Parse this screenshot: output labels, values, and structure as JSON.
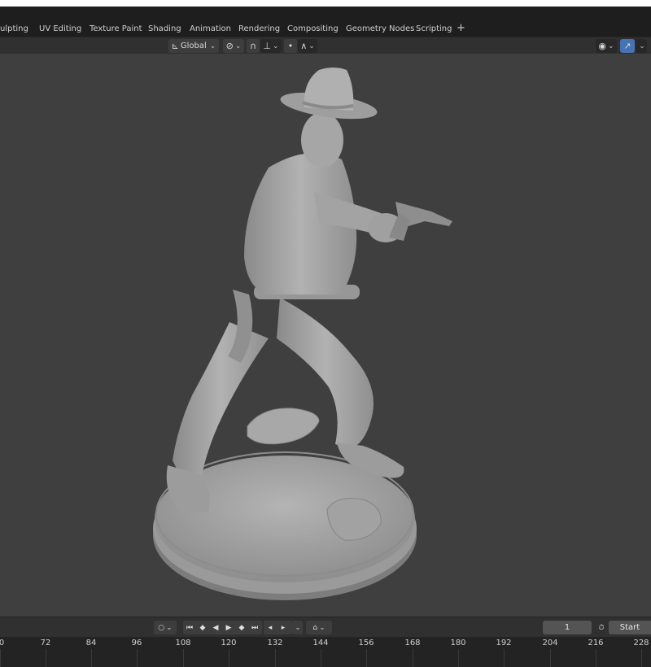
{
  "workspace_tabs": [
    {
      "label": "ulpting"
    },
    {
      "label": "UV Editing"
    },
    {
      "label": "Texture Paint"
    },
    {
      "label": "Shading"
    },
    {
      "label": "Animation"
    },
    {
      "label": "Rendering"
    },
    {
      "label": "Compositing"
    },
    {
      "label": "Geometry Nodes"
    },
    {
      "label": "Scripting"
    }
  ],
  "add_workspace_label": "+",
  "header": {
    "transform_orientation": "Global",
    "pivot_icon": "transform-pivot-icon",
    "snap_icon": "snap-magnet-icon",
    "proportional_icon": "proportional-edit-icon",
    "visibility_icon": "eye-visibility-icon",
    "gizmo_icon": "gizmo-icon"
  },
  "viewport": {
    "subject": "sculpt",
    "background_color": "#3f3f3f",
    "model_color": "#a9a9a9"
  },
  "timeline": {
    "current_frame": "1",
    "start_label": "Start",
    "ruler_ticks": [
      "0",
      "72",
      "84",
      "96",
      "108",
      "120",
      "132",
      "144",
      "156",
      "168",
      "180",
      "192",
      "204",
      "216",
      "228"
    ]
  }
}
